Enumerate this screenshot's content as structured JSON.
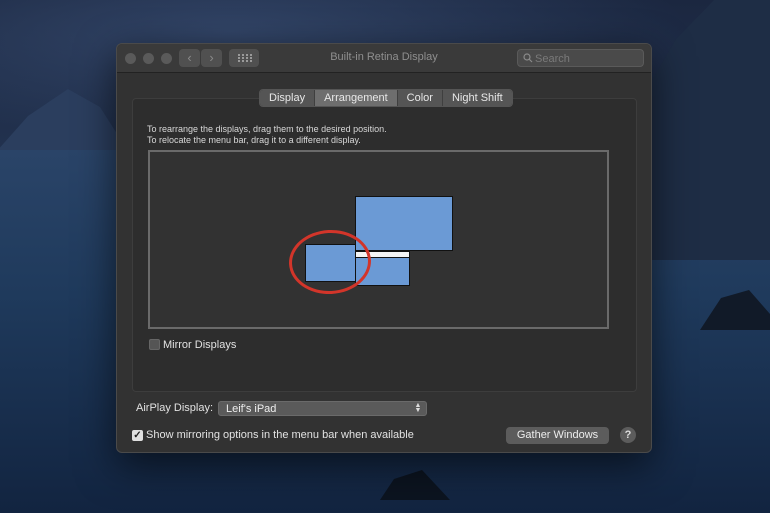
{
  "window": {
    "title": "Built-in Retina Display",
    "search_placeholder": "Search"
  },
  "tabs": [
    {
      "label": "Display",
      "active": false
    },
    {
      "label": "Arrangement",
      "active": true
    },
    {
      "label": "Color",
      "active": false
    },
    {
      "label": "Night Shift",
      "active": false
    }
  ],
  "arrangement": {
    "hint_line1": "To rearrange the displays, drag them to the desired position.",
    "hint_line2": "To relocate the menu bar, drag it to a different display.",
    "display_color": "#6b9ad5",
    "annotation_color": "#d2352a"
  },
  "mirror_displays": {
    "label": "Mirror Displays",
    "checked": false
  },
  "airplay": {
    "label": "AirPlay Display:",
    "value": "Leif's iPad"
  },
  "mirroring_options": {
    "label": "Show mirroring options in the menu bar when available",
    "checked": true
  },
  "gather_button": "Gather Windows",
  "help_button": "?"
}
